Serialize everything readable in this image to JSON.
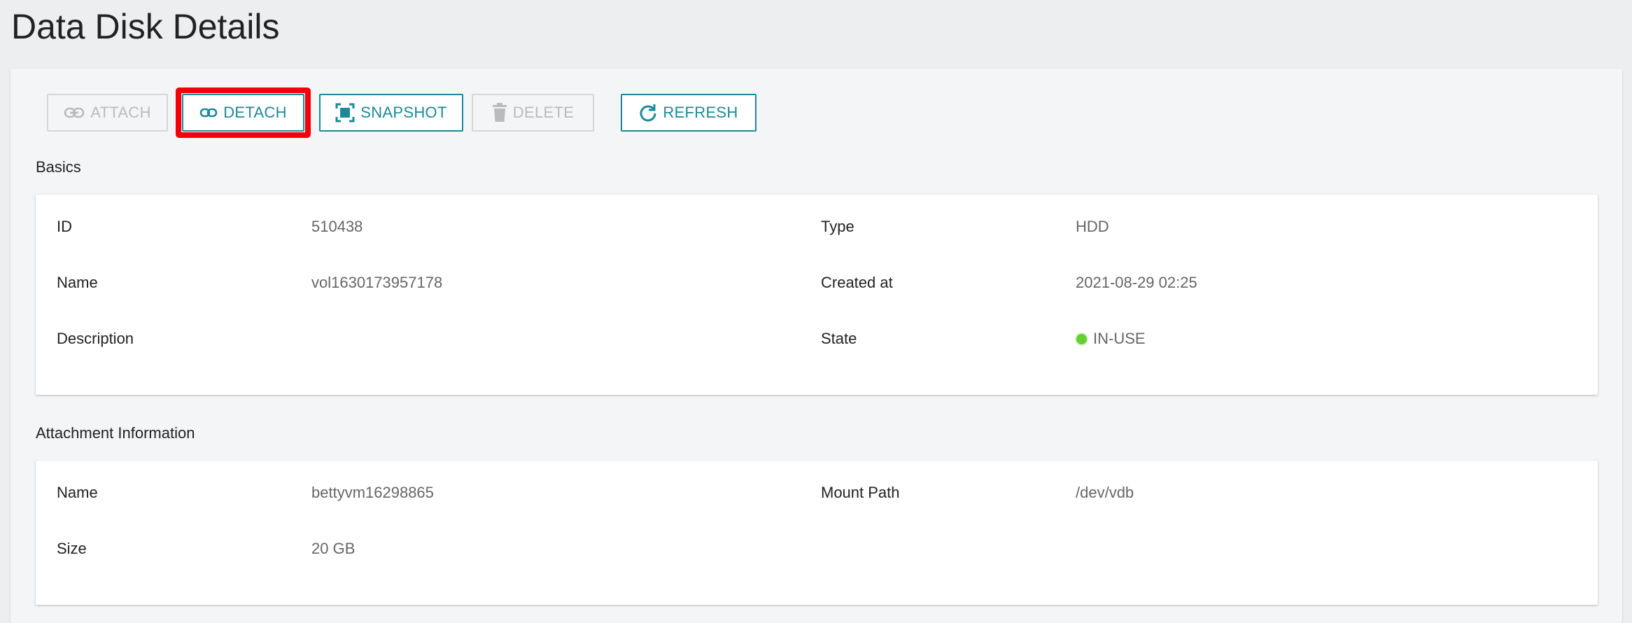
{
  "page": {
    "title": "Data Disk Details"
  },
  "toolbar": {
    "attach_label": "ATTACH",
    "detach_label": "DETACH",
    "snapshot_label": "SNAPSHOT",
    "delete_label": "DELETE",
    "refresh_label": "REFRESH",
    "attach_icon": "link-icon",
    "detach_icon": "unlink-icon",
    "snapshot_icon": "snapshot-icon",
    "delete_icon": "trash-icon",
    "refresh_icon": "refresh-icon"
  },
  "basics": {
    "section_label": "Basics",
    "id_key": "ID",
    "id_value": "510438",
    "name_key": "Name",
    "name_value": "vol1630173957178",
    "description_key": "Description",
    "description_value": "",
    "type_key": "Type",
    "type_value": "HDD",
    "created_key": "Created at",
    "created_value": "2021-08-29 02:25",
    "state_key": "State",
    "state_value": "IN-USE"
  },
  "attachment": {
    "section_label": "Attachment Information",
    "name_key": "Name",
    "name_value": "bettyvm16298865",
    "size_key": "Size",
    "size_value": "20 GB",
    "mount_key": "Mount Path",
    "mount_value": "/dev/vdb"
  },
  "colors": {
    "accent": "#1b8a98",
    "highlight": "#f2000b",
    "status_ok": "#62d02f",
    "disabled": "#bbbbbb"
  }
}
